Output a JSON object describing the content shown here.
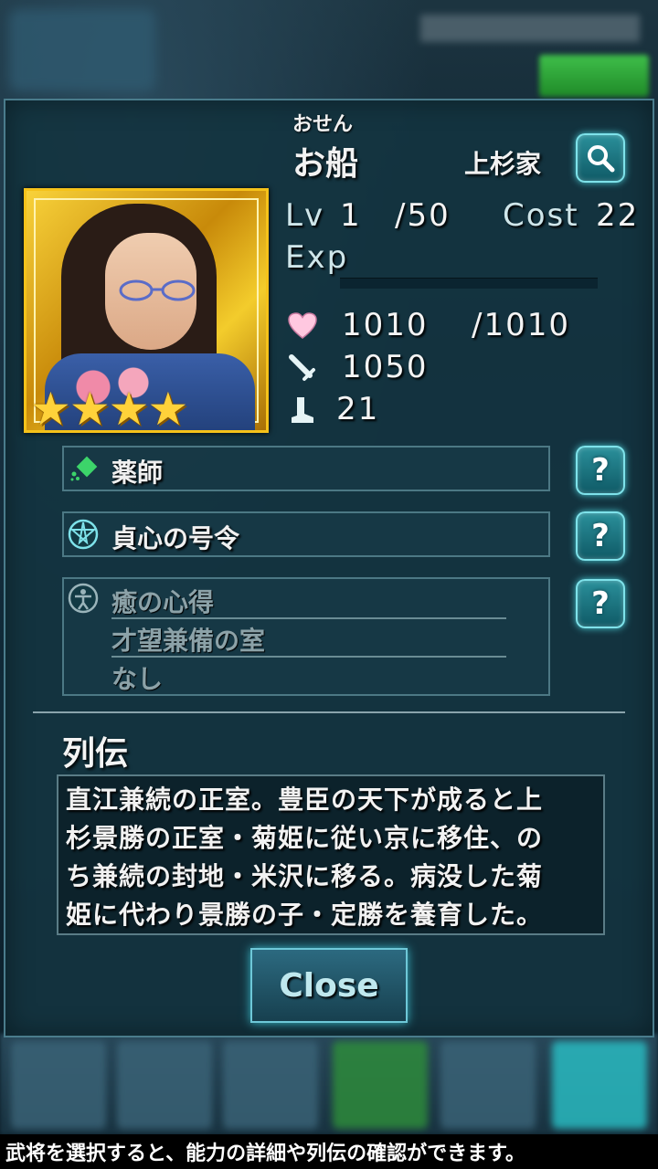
{
  "character": {
    "reading": "おせん",
    "name": "お船",
    "clan": "上杉家",
    "rarity_stars": 4
  },
  "stats": {
    "lv_label": "Lv",
    "lv": "1",
    "lv_max": "/50",
    "cost_label": "Cost",
    "cost": "22",
    "exp_label": "Exp",
    "exp_fraction": 0,
    "hp": "1010",
    "hp_max": "/1010",
    "attack": "1050",
    "speed": "21"
  },
  "skills": {
    "class_name": "薬師",
    "command_skill": "貞心の号令",
    "passive": [
      "癒の心得",
      "才望兼備の室",
      "なし"
    ]
  },
  "bio": {
    "title": "列伝",
    "lines": [
      "直江兼続の正室。豊臣の天下が成ると上",
      "杉景勝の正室・菊姫に従い京に移住、の",
      "ち兼続の封地・米沢に移る。病没した菊",
      "姫に代わり景勝の子・定勝を養育した。"
    ]
  },
  "buttons": {
    "close_label": "Close",
    "help_label": "?"
  },
  "footer": {
    "hint": "武将を選択すると、能力の詳細や列伝の確認ができます。"
  },
  "colors": {
    "accent_cyan": "#48c8d2",
    "frame_gold": "#f5c21a",
    "heart_pink": "#ffc8e0"
  }
}
